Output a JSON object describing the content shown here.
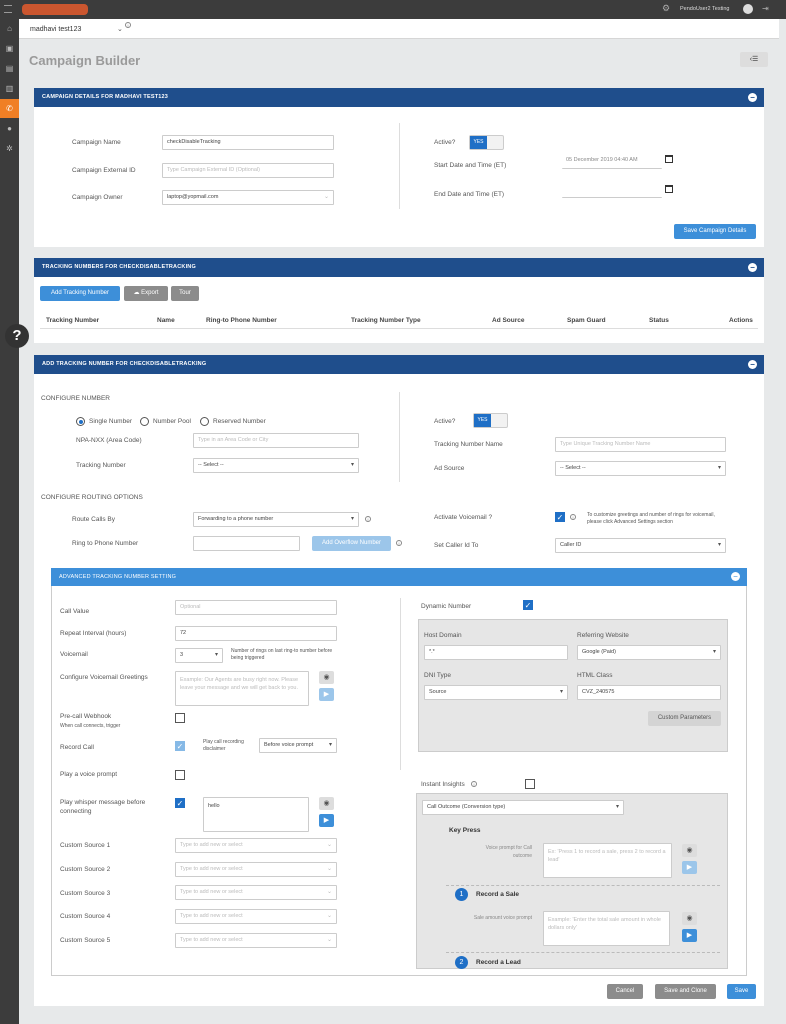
{
  "topbar": {
    "user": "PendoUser2 Testing",
    "gear_icon": "gear-icon",
    "exit_icon": "logout-icon"
  },
  "subheader": {
    "account": "madhavi test123"
  },
  "page": {
    "title": "Campaign Builder"
  },
  "campaign_details": {
    "header": "CAMPAIGN DETAILS FOR MADHAVI TEST123",
    "name_label": "Campaign Name",
    "name_value": "checkDisableTracking",
    "external_id_label": "Campaign External ID",
    "external_id_placeholder": "Type Campaign External ID (Optional)",
    "owner_label": "Campaign Owner",
    "owner_value": "laptop@yopmail.com",
    "active_label": "Active?",
    "active_value": "YES",
    "start_label": "Start Date and Time (ET)",
    "start_value": "05 December 2019 04:40 AM",
    "end_label": "End Date and Time (ET)",
    "save_label": "Save Campaign Details"
  },
  "tracking_numbers": {
    "header": "TRACKING NUMBERS FOR CHECKDISABLETRACKING",
    "add_label": "Add Tracking Number",
    "export_label": "Export",
    "tour_label": "Tour",
    "columns": [
      "Tracking Number",
      "Name",
      "Ring-to Phone Number",
      "Tracking Number Type",
      "Ad Source",
      "Spam Guard",
      "Status",
      "Actions"
    ]
  },
  "add_tracking": {
    "header": "ADD TRACKING NUMBER FOR CHECKDISABLETRACKING",
    "configure_number": "CONFIGURE NUMBER",
    "radio_single": "Single Number",
    "radio_pool": "Number Pool",
    "radio_reserved": "Reserved Number",
    "npa_label": "NPA-NXX (Area Code)",
    "npa_placeholder": "Type in an Area Code or City",
    "tracking_number_label": "Tracking Number",
    "tracking_number_value": "-- Select --",
    "active_label": "Active?",
    "active_value": "YES",
    "tn_name_label": "Tracking Number Name",
    "tn_name_placeholder": "Type Unique Tracking Number Name",
    "ad_source_label": "Ad Source",
    "ad_source_value": "-- Select --",
    "configure_routing": "CONFIGURE ROUTING OPTIONS",
    "route_label": "Route Calls By",
    "route_value": "Forwarding to a phone number",
    "ring_label": "Ring to Phone Number",
    "overflow_label": "Add Overflow Number",
    "voicemail_label": "Activate Voicemail ?",
    "voicemail_note": "To customize greetings and number of rings for voicemail, please click Advanced Settings section",
    "caller_id_label": "Set Caller Id To",
    "caller_id_value": "Caller ID"
  },
  "advanced": {
    "header": "ADVANCED TRACKING NUMBER SETTING",
    "call_value_label": "Call Value",
    "call_value_placeholder": "Optional",
    "repeat_label": "Repeat Interval (hours)",
    "repeat_value": "72",
    "voicemail_label": "Voicemail",
    "voicemail_value": "3",
    "voicemail_note": "Number of rings on last ring-to number before being triggered",
    "greetings_label": "Configure Voicemail Greetings",
    "greetings_placeholder": "Example: Our Agents are busy right now. Please leave your message and we will get back to you.",
    "precall_label": "Pre-call Webhook",
    "precall_sub": "When call connects, trigger",
    "record_label": "Record Call",
    "record_disclaimer": "Play call recording disclaimer",
    "record_when": "Before voice prompt",
    "voice_prompt_label": "Play a voice prompt",
    "whisper_label": "Play whisper message before connecting",
    "whisper_value": "hello",
    "custom_sources": [
      "Custom Source 1",
      "Custom Source 2",
      "Custom Source 3",
      "Custom Source 4",
      "Custom Source 5"
    ],
    "custom_placeholder": "Type to add new or select",
    "dynamic_label": "Dynamic Number",
    "host_label": "Host Domain",
    "host_value": "*.*",
    "referring_label": "Referring Website",
    "referring_value": "Google (Paid)",
    "dni_label": "DNI Type",
    "dni_value": "Source",
    "html_label": "HTML Class",
    "html_value": "CVZ_240575",
    "custom_params_label": "Custom Parameters",
    "insights_label": "Instant Insights",
    "outcome_value": "Call Outcome (Conversion type)",
    "key_press": "Key Press",
    "voice_prompt_outcome_label": "Voice prompt for Call outcome",
    "voice_prompt_outcome_placeholder": "Ex: 'Press 1 to record a sale, press 2 to record a lead'",
    "record_sale_num": "1",
    "record_sale": "Record a Sale",
    "sale_amount_label": "Sale amount voice prompt",
    "sale_amount_placeholder": "Example: 'Enter the total sale amount in whole dollars only'",
    "record_lead_num": "2",
    "record_lead": "Record a Lead"
  },
  "footer": {
    "cancel": "Cancel",
    "save_clone": "Save and Clone",
    "save": "Save"
  }
}
